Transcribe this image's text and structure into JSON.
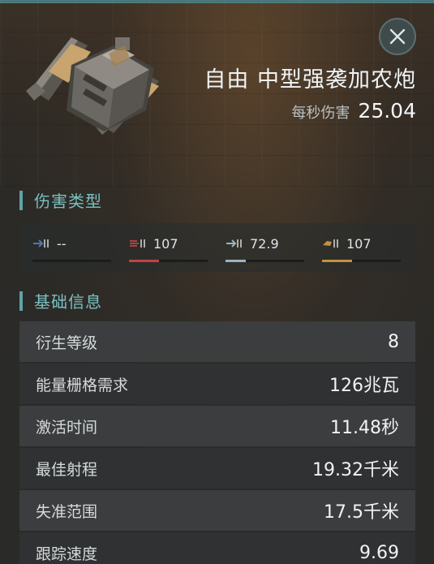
{
  "header": {
    "title": "自由 中型强袭加农炮",
    "dps_label": "每秒伤害",
    "dps_value": "25.04"
  },
  "icons": {
    "close": "close-icon",
    "weapon": "cannon-turret-icon"
  },
  "colors": {
    "accent": "#78c1c1",
    "em": "#4f79a8",
    "thermal": "#c4433f",
    "kinetic": "#9ab4be",
    "explosive": "#c49043"
  },
  "damage_section": {
    "title": "伤害类型",
    "items": [
      {
        "icon": "em-damage-icon",
        "value": "--",
        "fraction": 0.0
      },
      {
        "icon": "thermal-damage-icon",
        "value": "107",
        "fraction": 0.38
      },
      {
        "icon": "kinetic-damage-icon",
        "value": "72.9",
        "fraction": 0.26
      },
      {
        "icon": "explosive-damage-icon",
        "value": "107",
        "fraction": 0.38
      }
    ]
  },
  "basic_section": {
    "title": "基础信息",
    "rows": [
      {
        "label": "衍生等级",
        "value": "8"
      },
      {
        "label": "能量栅格需求",
        "value": "126兆瓦"
      },
      {
        "label": "激活时间",
        "value": "11.48秒"
      },
      {
        "label": "最佳射程",
        "value": "19.32千米"
      },
      {
        "label": "失准范围",
        "value": "17.5千米"
      },
      {
        "label": "跟踪速度",
        "value": "9.69"
      }
    ]
  }
}
